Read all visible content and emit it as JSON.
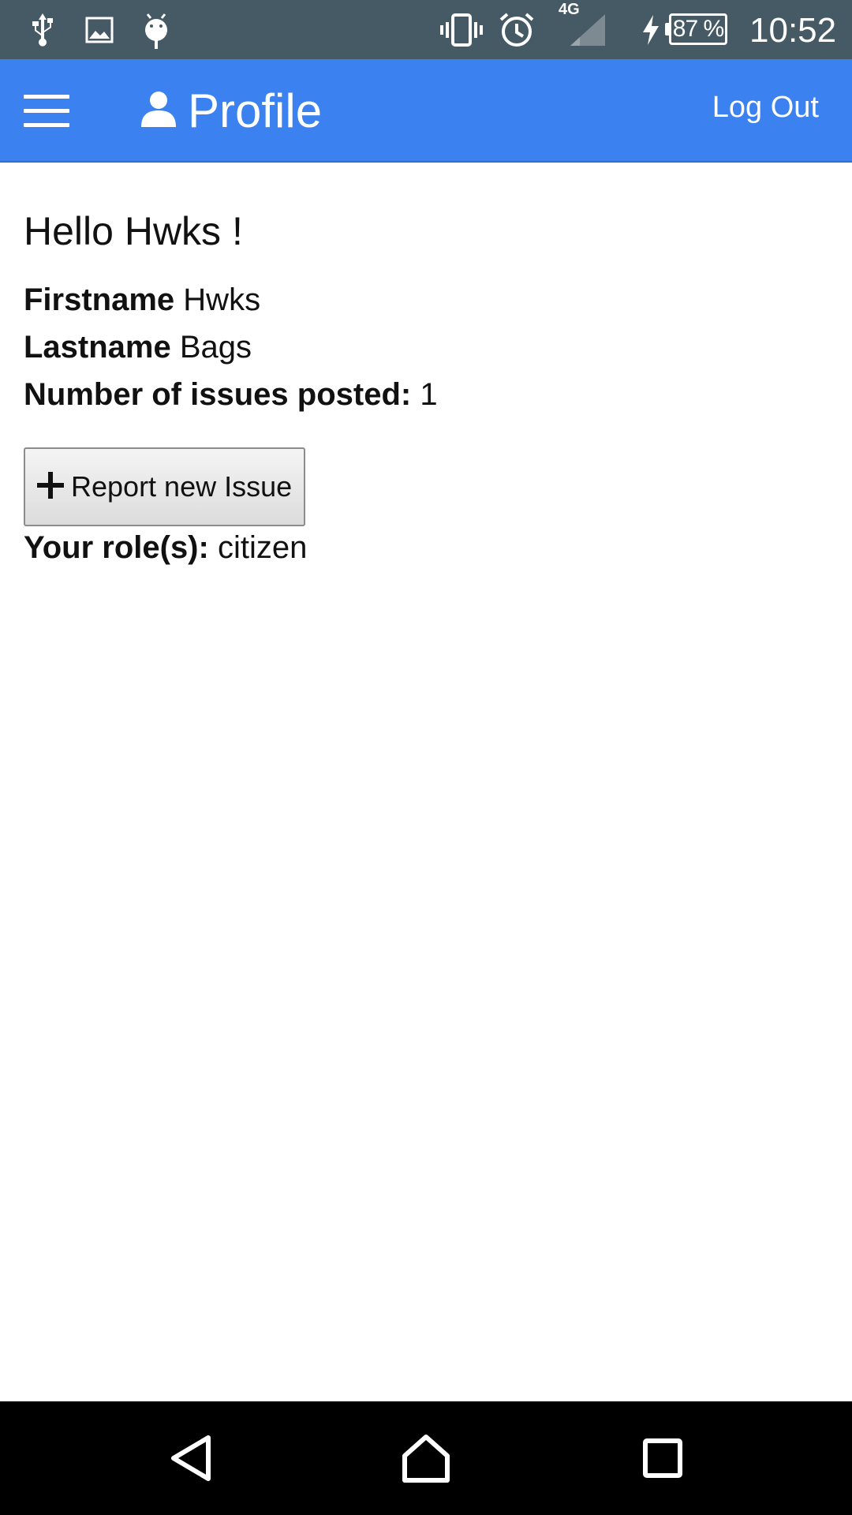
{
  "status_bar": {
    "network_type": "4G",
    "battery_percent": "87 %",
    "battery_level": 0.87,
    "time": "10:52",
    "icons": [
      "usb-icon",
      "image-icon",
      "android-debug-icon",
      "vibrate-icon",
      "alarm-icon",
      "signal-icon",
      "charging-icon",
      "battery-icon"
    ]
  },
  "app_bar": {
    "title": "Profile",
    "title_icon": "person-icon",
    "menu_icon": "hamburger-menu-icon",
    "logout_label": "Log Out",
    "background": "#3b82f0"
  },
  "profile": {
    "greeting": "Hello Hwks !",
    "firstname_label": "Firstname",
    "firstname_value": "Hwks",
    "lastname_label": "Lastname",
    "lastname_value": "Bags",
    "issues_label": "Number of issues posted:",
    "issues_value": "1",
    "report_button_label": "Report new Issue",
    "roles_label": "Your role(s):",
    "roles_value": "citizen"
  },
  "nav_bar": {
    "buttons": [
      "back-icon",
      "home-icon",
      "recents-icon"
    ]
  }
}
